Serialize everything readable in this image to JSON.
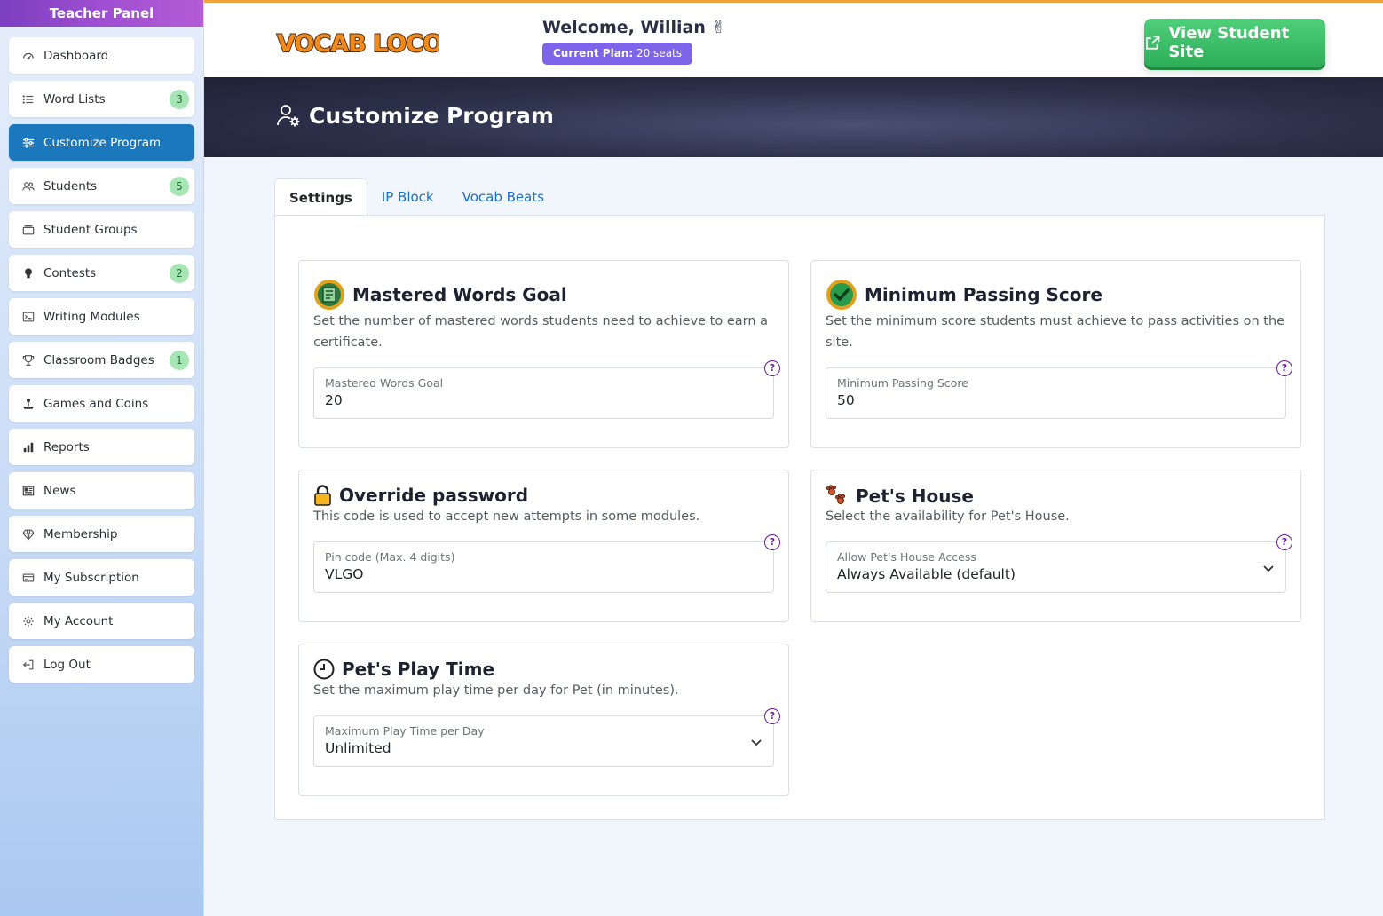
{
  "sidebar": {
    "title": "Teacher Panel",
    "items": [
      {
        "label": "Dashboard",
        "icon": "dashboard-icon"
      },
      {
        "label": "Word Lists",
        "icon": "list-icon",
        "badge": "3"
      },
      {
        "label": "Customize Program",
        "icon": "sliders-icon",
        "active": true
      },
      {
        "label": "Students",
        "icon": "users-icon",
        "badge": "5"
      },
      {
        "label": "Student Groups",
        "icon": "folder-icon"
      },
      {
        "label": "Contests",
        "icon": "medal-icon",
        "badge": "2"
      },
      {
        "label": "Writing Modules",
        "icon": "terminal-icon"
      },
      {
        "label": "Classroom Badges",
        "icon": "trophy-icon",
        "badge": "1"
      },
      {
        "label": "Games and Coins",
        "icon": "joystick-icon"
      },
      {
        "label": "Reports",
        "icon": "bar-chart-icon"
      },
      {
        "label": "News",
        "icon": "newspaper-icon"
      },
      {
        "label": "Membership",
        "icon": "diamond-icon"
      },
      {
        "label": "My Subscription",
        "icon": "credit-card-icon"
      },
      {
        "label": "My Account",
        "icon": "gear-icon"
      },
      {
        "label": "Log Out",
        "icon": "logout-icon"
      }
    ]
  },
  "header": {
    "logo_text": "VOCAB LOCO",
    "welcome": "Welcome, Willian ✌",
    "plan_label": "Current Plan:",
    "plan_value": "20 seats",
    "student_site_button": "View Student Site"
  },
  "hero": {
    "title": "Customize Program"
  },
  "tabs": [
    {
      "label": "Settings",
      "active": true
    },
    {
      "label": "IP Block"
    },
    {
      "label": "Vocab Beats"
    }
  ],
  "cards": {
    "mastered": {
      "title": "Mastered Words Goal",
      "description": "Set the number of mastered words students need to achieve to earn a certificate.",
      "field_label": "Mastered Words Goal",
      "field_value": "20"
    },
    "passing": {
      "title": "Minimum Passing Score",
      "description": "Set the minimum score students must achieve to pass activities on the site.",
      "field_label": "Minimum Passing Score",
      "field_value": "50"
    },
    "override": {
      "title": "Override password",
      "description": "This code is used to accept new attempts in some modules.",
      "field_label": "Pin code (Max. 4 digits)",
      "field_value": "VLGO"
    },
    "pets_house": {
      "title": "Pet's House",
      "description": "Select the availability for Pet's House.",
      "field_label": "Allow Pet's House Access",
      "field_value": "Always Available (default)"
    },
    "play_time": {
      "title": "Pet's Play Time",
      "description": "Set the maximum play time per day for Pet (in minutes).",
      "field_label": "Maximum Play Time per Day",
      "field_value": "Unlimited"
    }
  },
  "help_symbol": "?",
  "colors": {
    "sidebar_active": "#1b78bd",
    "badge_green": "#a5e6b4",
    "plan_purple": "#7d64e8",
    "student_site_green": "#2eae58",
    "help_purple": "#6a1b9a",
    "header_border_orange": "#f0a33c"
  }
}
